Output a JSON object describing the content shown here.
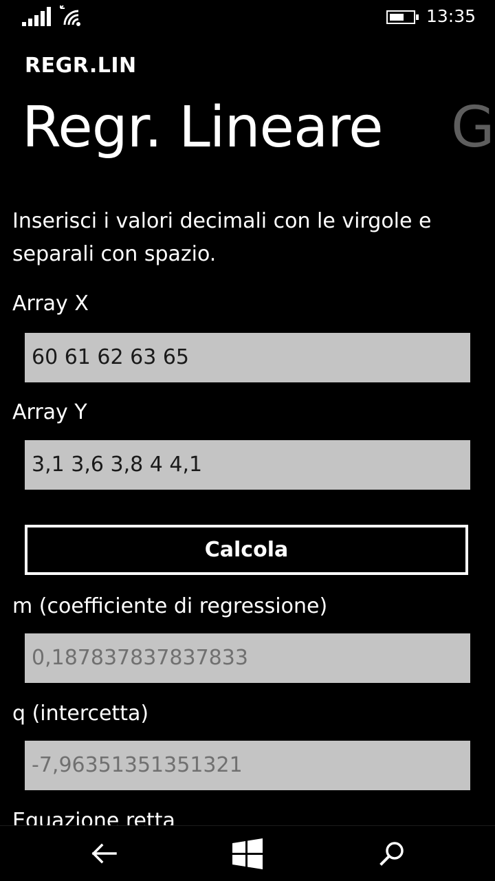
{
  "status": {
    "time": "13:35",
    "icons": [
      "signal-icon",
      "wifi-icon",
      "battery-icon"
    ]
  },
  "app": {
    "title": "REGR.LIN"
  },
  "pivot": {
    "items": [
      "Regr. Lineare",
      "G"
    ],
    "active_index": 0
  },
  "form": {
    "instructions": "Inserisci i valori decimali con le virgole e separali con spazio.",
    "array_x": {
      "label": "Array X",
      "value": "60 61 62 63 65"
    },
    "array_y": {
      "label": "Array Y",
      "value": "3,1 3,6 3,8 4 4,1"
    },
    "calculate_label": "Calcola",
    "m": {
      "label": "m (coefficiente di regressione)",
      "value": "0,187837837837833"
    },
    "q": {
      "label": "q (intercetta)",
      "value": "-7,96351351351321"
    },
    "equation": {
      "label": "Equazione retta"
    }
  },
  "navbar": {
    "icons": [
      "back-arrow-icon",
      "windows-start-icon",
      "search-icon"
    ]
  },
  "colors": {
    "background": "#000000",
    "text": "#ffffff",
    "textbox_background": "#c4c4c4",
    "readonly_text": "#707070",
    "inactive_pivot": "#5e5e5e"
  }
}
